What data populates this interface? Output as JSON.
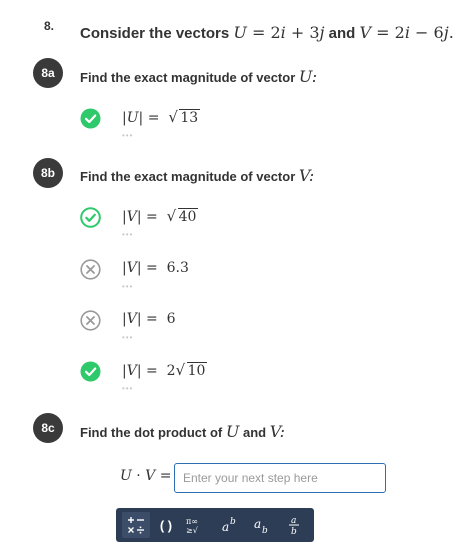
{
  "question": {
    "number": "8.",
    "text_prefix": "Consider the vectors",
    "u_expr": "U = 2i + 3j",
    "and_text": "and",
    "v_expr": "V = 2i − 6j."
  },
  "parts": [
    {
      "badge": "8a",
      "prompt": "Find the exact magnitude of vector",
      "var": "U:",
      "steps": [
        {
          "status": "correct",
          "lhs": "|U|",
          "eq": "=",
          "rhs_sqrt": "13",
          "dots": "•••"
        }
      ]
    },
    {
      "badge": "8b",
      "prompt": "Find the exact magnitude of vector",
      "var": "V:",
      "steps": [
        {
          "status": "correct-outline",
          "lhs": "|V|",
          "eq": "=",
          "rhs_sqrt": "40",
          "dots": "•••"
        },
        {
          "status": "incorrect",
          "lhs": "|V|",
          "eq": "=",
          "rhs": "6.3",
          "dots": "•••"
        },
        {
          "status": "incorrect",
          "lhs": "|V|",
          "eq": "=",
          "rhs": "6",
          "dots": "•••"
        },
        {
          "status": "correct",
          "lhs": "|V|",
          "eq": "=",
          "rhs_coef": "2",
          "rhs_sqrt": "10",
          "dots": "•••"
        }
      ]
    },
    {
      "badge": "8c",
      "prompt_a": "Find the dot product of",
      "var_a": "U",
      "and_text": "and",
      "var_b": "V:",
      "input_label": "U · V =",
      "input_placeholder": "Enter your next step here",
      "input_value": ""
    }
  ],
  "toolbar": {
    "buttons": [
      {
        "name": "operators",
        "label": "+− ×÷"
      },
      {
        "name": "parentheses",
        "label": "( )"
      },
      {
        "name": "pi-infinity-sqrt",
        "label": "π∞ ≥√"
      },
      {
        "name": "superscript",
        "label": "a"
      },
      {
        "name": "subscript",
        "label": "a"
      },
      {
        "name": "fraction",
        "label": "a/b"
      }
    ]
  },
  "colors": {
    "correct_green": "#2dc96b",
    "incorrect_gray": "#9a9a9a",
    "badge_dark": "#3a3a3a",
    "input_border": "#2d6fb3",
    "toolbar_bg": "#2e3d56"
  }
}
